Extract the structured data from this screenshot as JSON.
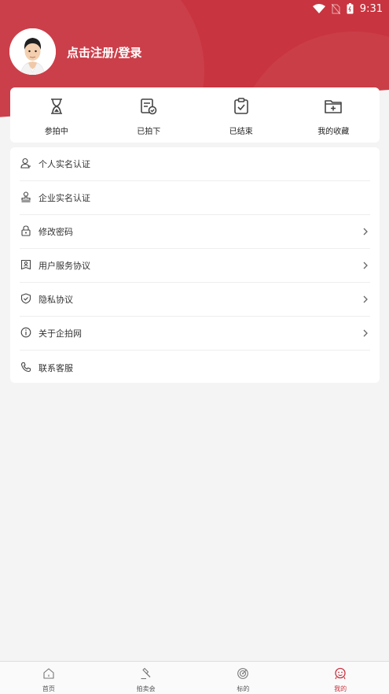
{
  "status_bar": {
    "time": "9:31"
  },
  "profile": {
    "login_text": "点击注册/登录"
  },
  "stats": [
    {
      "label": "参拍中",
      "icon": "hourglass-icon"
    },
    {
      "label": "已拍下",
      "icon": "document-check-icon"
    },
    {
      "label": "已结束",
      "icon": "clipboard-check-icon"
    },
    {
      "label": "我的收藏",
      "icon": "folder-plus-icon"
    }
  ],
  "menu": [
    {
      "label": "个人实名认证",
      "icon": "person-icon",
      "chevron": false
    },
    {
      "label": "企业实名认证",
      "icon": "stamp-icon",
      "chevron": false
    },
    {
      "label": "修改密码",
      "icon": "lock-icon",
      "chevron": true
    },
    {
      "label": "用户服务协议",
      "icon": "user-agreement-icon",
      "chevron": true
    },
    {
      "label": "隐私协议",
      "icon": "shield-check-icon",
      "chevron": true
    },
    {
      "label": "关于企拍网",
      "icon": "info-icon",
      "chevron": true
    },
    {
      "label": "联系客服",
      "icon": "phone-icon",
      "chevron": false
    }
  ],
  "tabs": [
    {
      "label": "首页",
      "icon": "home-icon",
      "active": false
    },
    {
      "label": "拍卖会",
      "icon": "gavel-icon",
      "active": false
    },
    {
      "label": "标的",
      "icon": "target-icon",
      "active": false
    },
    {
      "label": "我的",
      "icon": "profile-icon",
      "active": true
    }
  ],
  "colors": {
    "brand": "#c8343f",
    "background": "#f4f4f4"
  }
}
